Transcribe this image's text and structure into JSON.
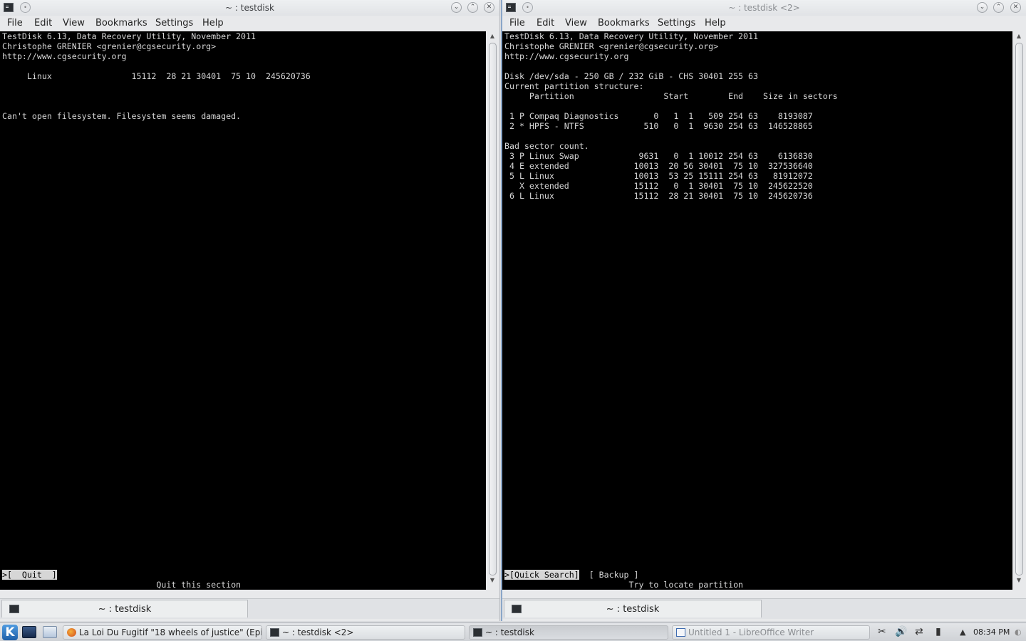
{
  "left_window": {
    "title": "~ : testdisk",
    "menu": [
      "File",
      "Edit",
      "View",
      "Bookmarks",
      "Settings",
      "Help"
    ],
    "lines": [
      "TestDisk 6.13, Data Recovery Utility, November 2011",
      "Christophe GRENIER <grenier@cgsecurity.org>",
      "http://www.cgsecurity.org",
      "",
      "     Linux                15112  28 21 30401  75 10  245620736",
      "",
      "",
      "",
      "Can't open filesystem. Filesystem seems damaged."
    ],
    "menu_selected": ">[  Quit  ]",
    "menu_hint": "                               Quit this section",
    "tab": "~ : testdisk"
  },
  "right_window": {
    "title": "~ : testdisk <2>",
    "menu": [
      "File",
      "Edit",
      "View",
      "Bookmarks",
      "Settings",
      "Help"
    ],
    "lines": [
      "TestDisk 6.13, Data Recovery Utility, November 2011",
      "Christophe GRENIER <grenier@cgsecurity.org>",
      "http://www.cgsecurity.org",
      "",
      "Disk /dev/sda - 250 GB / 232 GiB - CHS 30401 255 63",
      "Current partition structure:",
      "     Partition                  Start        End    Size in sectors",
      "",
      " 1 P Compaq Diagnostics       0   1  1   509 254 63    8193087",
      " 2 * HPFS - NTFS            510   0  1  9630 254 63  146528865",
      "",
      "Bad sector count.",
      " 3 P Linux Swap            9631   0  1 10012 254 63    6136830",
      " 4 E extended             10013  20 56 30401  75 10  327536640",
      " 5 L Linux                10013  53 25 15111 254 63   81912072",
      "   X extended             15112   0  1 30401  75 10  245622520",
      " 6 L Linux                15112  28 21 30401  75 10  245620736"
    ],
    "menu_selected": ">[Quick Search]",
    "menu_rest": "  [ Backup ]",
    "menu_hint": "                         Try to locate partition",
    "tab": "~ : testdisk"
  },
  "taskbar": {
    "tasks": [
      {
        "label": "La Loi Du Fugitif \"18 wheels of justice\" (Episo"
      },
      {
        "label": "~ : testdisk <2>"
      },
      {
        "label": "~ : testdisk"
      },
      {
        "label": "Untitled 1 - LibreOffice Writer"
      }
    ],
    "clock": "08:34 PM"
  },
  "colors": {
    "terminal_bg": "#000000",
    "terminal_fg": "#d6d6d6",
    "active_border": "#8aa6c8"
  }
}
